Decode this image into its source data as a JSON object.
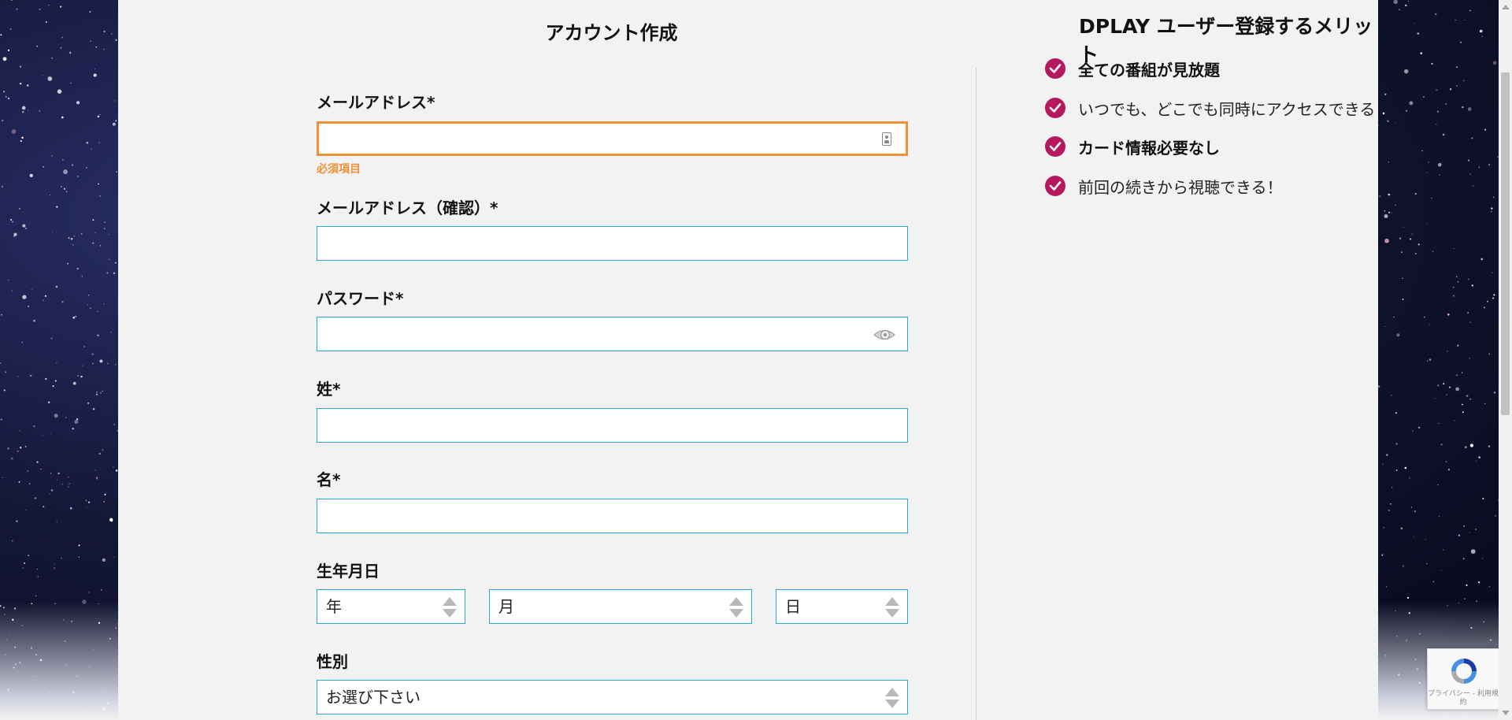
{
  "form": {
    "title": "アカウント作成",
    "email_label": "メールアドレス*",
    "email_error": "必須項目",
    "email_confirm_label": "メールアドレス（確認）*",
    "password_label": "パスワード*",
    "last_name_label": "姓*",
    "first_name_label": "名*",
    "birthdate_label": "生年月日",
    "year_placeholder": "年",
    "month_placeholder": "月",
    "day_placeholder": "日",
    "gender_label": "性別",
    "gender_placeholder": "お選び下さい"
  },
  "benefits": {
    "title": "DPLAY ユーザー登録するメリット",
    "items": [
      {
        "text": "全ての番組が見放題",
        "bold": true
      },
      {
        "text": "いつでも、どこでも同時にアクセスできる",
        "bold": false
      },
      {
        "text": "カード情報必要なし",
        "bold": true
      },
      {
        "text": "前回の続きから視聴できる！",
        "bold": false
      }
    ]
  },
  "recaptcha": {
    "text": "プライバシー - 利用規約"
  },
  "colors": {
    "accent_border": "#29a8d8",
    "error": "#f09135",
    "check": "#b5185f",
    "panel": "#f2f2f2"
  },
  "icons": [
    "contact-card-icon",
    "password-visibility-icon",
    "check-icon",
    "recaptcha-icon"
  ]
}
